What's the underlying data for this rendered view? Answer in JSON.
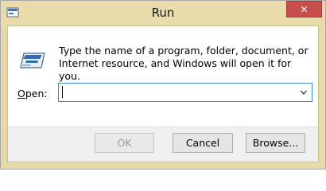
{
  "window": {
    "title": "Run",
    "close_glyph": "✕"
  },
  "icons": {
    "app": "run-app-icon",
    "run": "run-dialog-icon",
    "close": "close-icon",
    "dropdown": "chevron-down-icon"
  },
  "dialog": {
    "description": "Type the name of a program, folder, document, or Internet resource, and Windows will open it for you.",
    "open_label_accel": "O",
    "open_label_rest": "pen:",
    "open_value": "",
    "dropdown_glyph": "⌄"
  },
  "buttons": {
    "ok": "OK",
    "cancel": "Cancel",
    "browse": "Browse..."
  },
  "colors": {
    "accent_border": "#3a8bd4",
    "close_button": "#c7504f",
    "frame": "#e9dcaa"
  }
}
